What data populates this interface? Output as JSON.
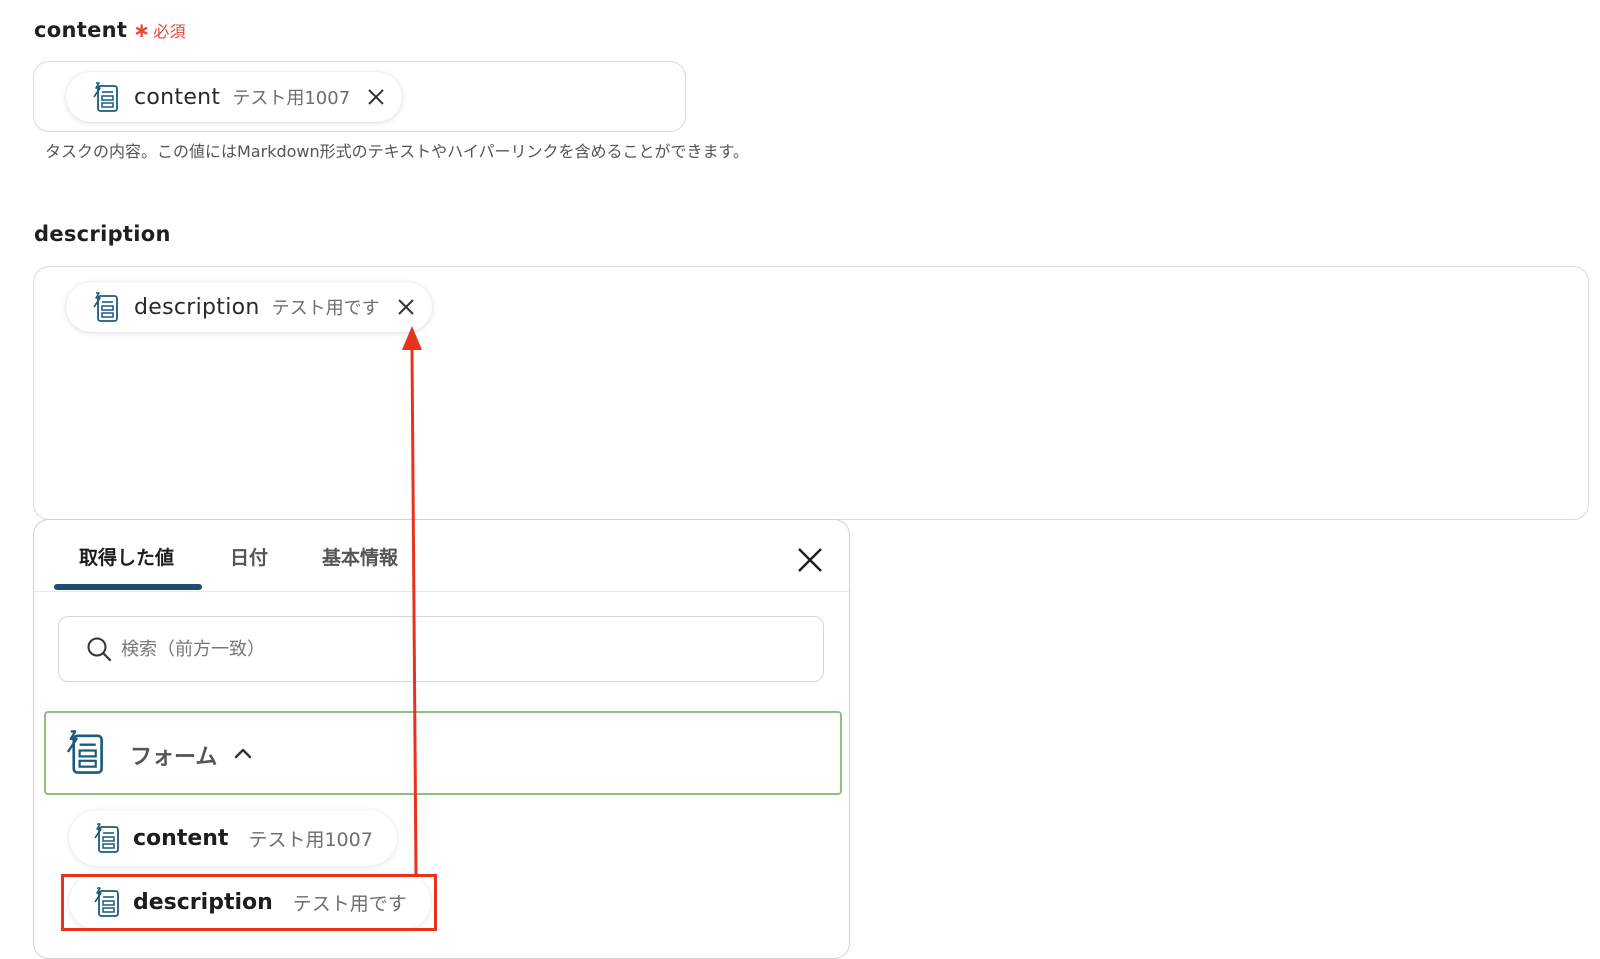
{
  "content_field": {
    "label": "content",
    "required_mark": "∗",
    "required_text": "必須",
    "chip": {
      "name": "content",
      "value": "テスト用1007",
      "icon": "form-icon",
      "remove_icon": "close-icon"
    },
    "help_text": "タスクの内容。この値にはMarkdown形式のテキストやハイパーリンクを含めることができます。"
  },
  "description_field": {
    "label": "description",
    "chip": {
      "name": "description",
      "value": "テスト用です",
      "icon": "form-icon",
      "remove_icon": "close-icon"
    }
  },
  "picker": {
    "tabs": [
      {
        "label": "取得した値",
        "active": true
      },
      {
        "label": "日付",
        "active": false
      },
      {
        "label": "基本情報",
        "active": false
      }
    ],
    "close_icon": "close-icon",
    "search": {
      "placeholder": "検索（前方一致）",
      "value": "",
      "icon": "search-icon"
    },
    "group": {
      "title": "フォーム",
      "icon": "form-icon",
      "expanded": true,
      "items": [
        {
          "name": "content",
          "value": "テスト用1007"
        },
        {
          "name": "description",
          "value": "テスト用です",
          "highlighted": true
        }
      ]
    }
  },
  "colors": {
    "required": "#e8453c",
    "tab_underline": "#1b4e73",
    "group_border": "#8cc27b",
    "annotation": "#e8331c",
    "icon": "#1b5b7d"
  }
}
